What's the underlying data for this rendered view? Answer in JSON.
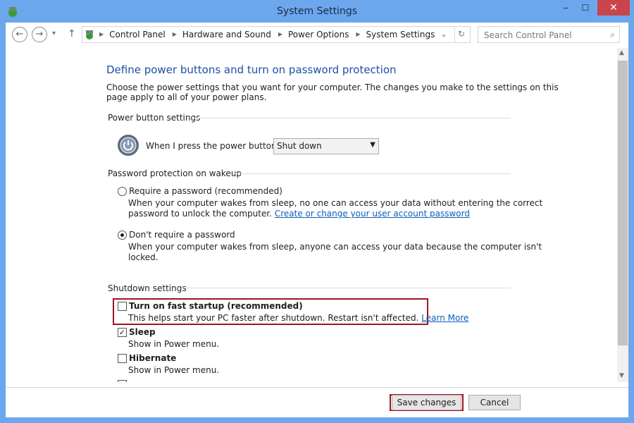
{
  "window": {
    "title": "System Settings",
    "minimize": "‒",
    "maximize": "☐",
    "close": "✕"
  },
  "nav": {
    "back": "←",
    "forward": "→",
    "recent": "▾",
    "up": "↑",
    "breadcrumb": [
      "Control Panel",
      "Hardware and Sound",
      "Power Options",
      "System Settings"
    ],
    "search_placeholder": "Search Control Panel"
  },
  "main": {
    "heading": "Define power buttons and turn on password protection",
    "intro": "Choose the power settings that you want for your computer. The changes you make to the settings on this",
    "intro2": "page apply to all of your power plans.",
    "power_section": "Power button settings",
    "power_label": "When I press the power button:",
    "power_value": "Shut down",
    "password_section": "Password protection on wakeup",
    "require_label": "Require a password (recommended)",
    "require_desc1": "When your computer wakes from sleep, no one can access your data without entering the correct",
    "require_desc2": "password to unlock the computer.",
    "require_link": "Create or change your user account password",
    "require_checked": false,
    "norequire_label": "Don't require a password",
    "norequire_desc1": "When your computer wakes from sleep, anyone can access your data because the computer isn't",
    "norequire_desc2": "locked.",
    "norequire_checked": true,
    "shutdown_section": "Shutdown settings",
    "fast_label": "Turn on fast startup (recommended)",
    "fast_desc": "This helps start your PC faster after shutdown. Restart isn't affected.",
    "fast_link": "Learn More",
    "fast_checked": false,
    "sleep_label": "Sleep",
    "sleep_desc": "Show in Power menu.",
    "sleep_checked": true,
    "hibernate_label": "Hibernate",
    "hibernate_desc": "Show in Power menu.",
    "hibernate_checked": false
  },
  "footer": {
    "save": "Save changes",
    "cancel": "Cancel"
  },
  "colors": {
    "frame": "#6ca7ee",
    "highlight": "#a0141e",
    "link": "#0c5fb7",
    "heading": "#1e4fa3"
  }
}
